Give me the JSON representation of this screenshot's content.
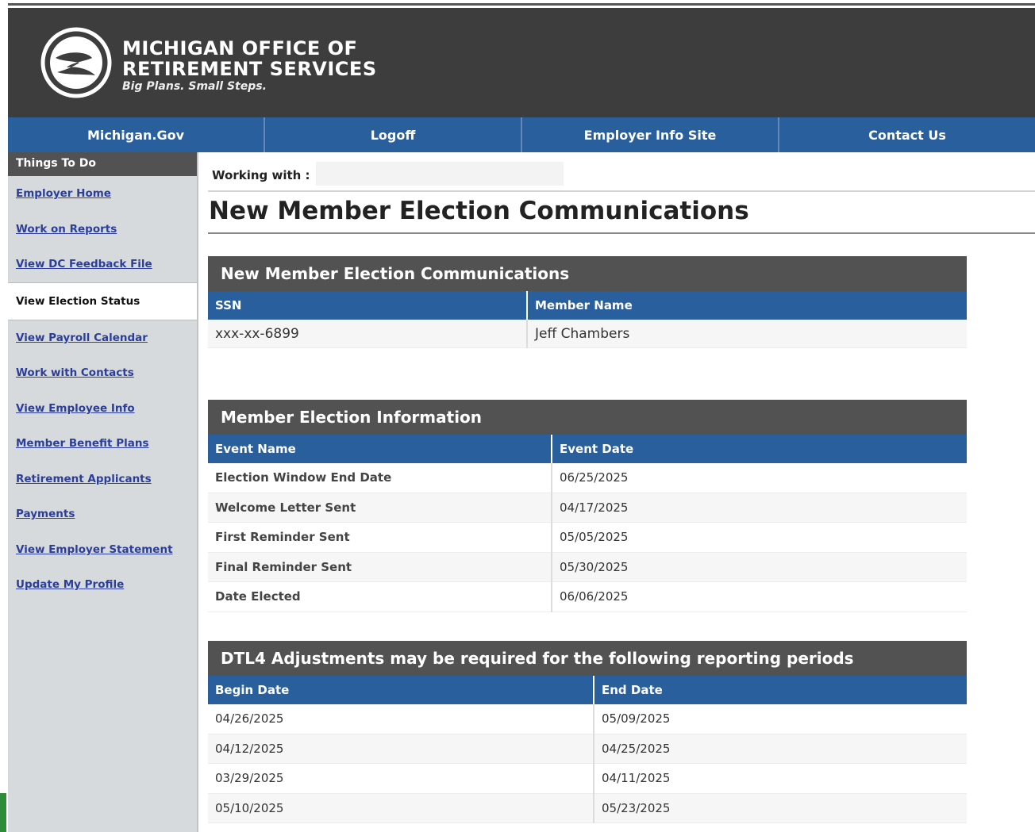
{
  "brand": {
    "line1": "MICHIGAN OFFICE OF",
    "line2": "RETIREMENT SERVICES",
    "tagline": "Big Plans. Small Steps."
  },
  "nav": [
    "Michigan.Gov",
    "Logoff",
    "Employer Info Site",
    "Contact Us"
  ],
  "sidebar": {
    "title": "Things To Do",
    "items": [
      "Employer Home",
      "Work on Reports",
      "View DC Feedback File",
      "View Election Status",
      "View Payroll Calendar",
      "Work with Contacts",
      "View Employee Info",
      "Member Benefit Plans",
      "Retirement Applicants",
      "Payments",
      "View Employer Statement",
      "Update My Profile"
    ]
  },
  "working_with_label": "Working with :",
  "page_title": "New Member Election Communications",
  "member_panel": {
    "title": "New Member Election Communications",
    "headers": [
      "SSN",
      "Member Name"
    ],
    "row": [
      "xxx-xx-6899",
      "Jeff Chambers"
    ]
  },
  "election_panel": {
    "title": "Member Election Information",
    "headers": [
      "Event Name",
      "Event Date"
    ],
    "rows": [
      [
        "Election Window End Date",
        "06/25/2025"
      ],
      [
        "Welcome Letter Sent",
        "04/17/2025"
      ],
      [
        "First Reminder Sent",
        "05/05/2025"
      ],
      [
        "Final Reminder Sent",
        "05/30/2025"
      ],
      [
        "Date Elected",
        "06/06/2025"
      ]
    ]
  },
  "dtl_panel": {
    "title": "DTL4 Adjustments may be required for the following reporting periods",
    "headers": [
      "Begin Date",
      "End Date"
    ],
    "rows": [
      [
        "04/26/2025",
        "05/09/2025"
      ],
      [
        "04/12/2025",
        "04/25/2025"
      ],
      [
        "03/29/2025",
        "04/11/2025"
      ],
      [
        "05/10/2025",
        "05/23/2025"
      ]
    ]
  },
  "colors": {
    "header_bg": "#3d3d3d",
    "nav_blue": "#2a5f9e",
    "panel_head": "#525252",
    "link": "#2b3e9c"
  }
}
